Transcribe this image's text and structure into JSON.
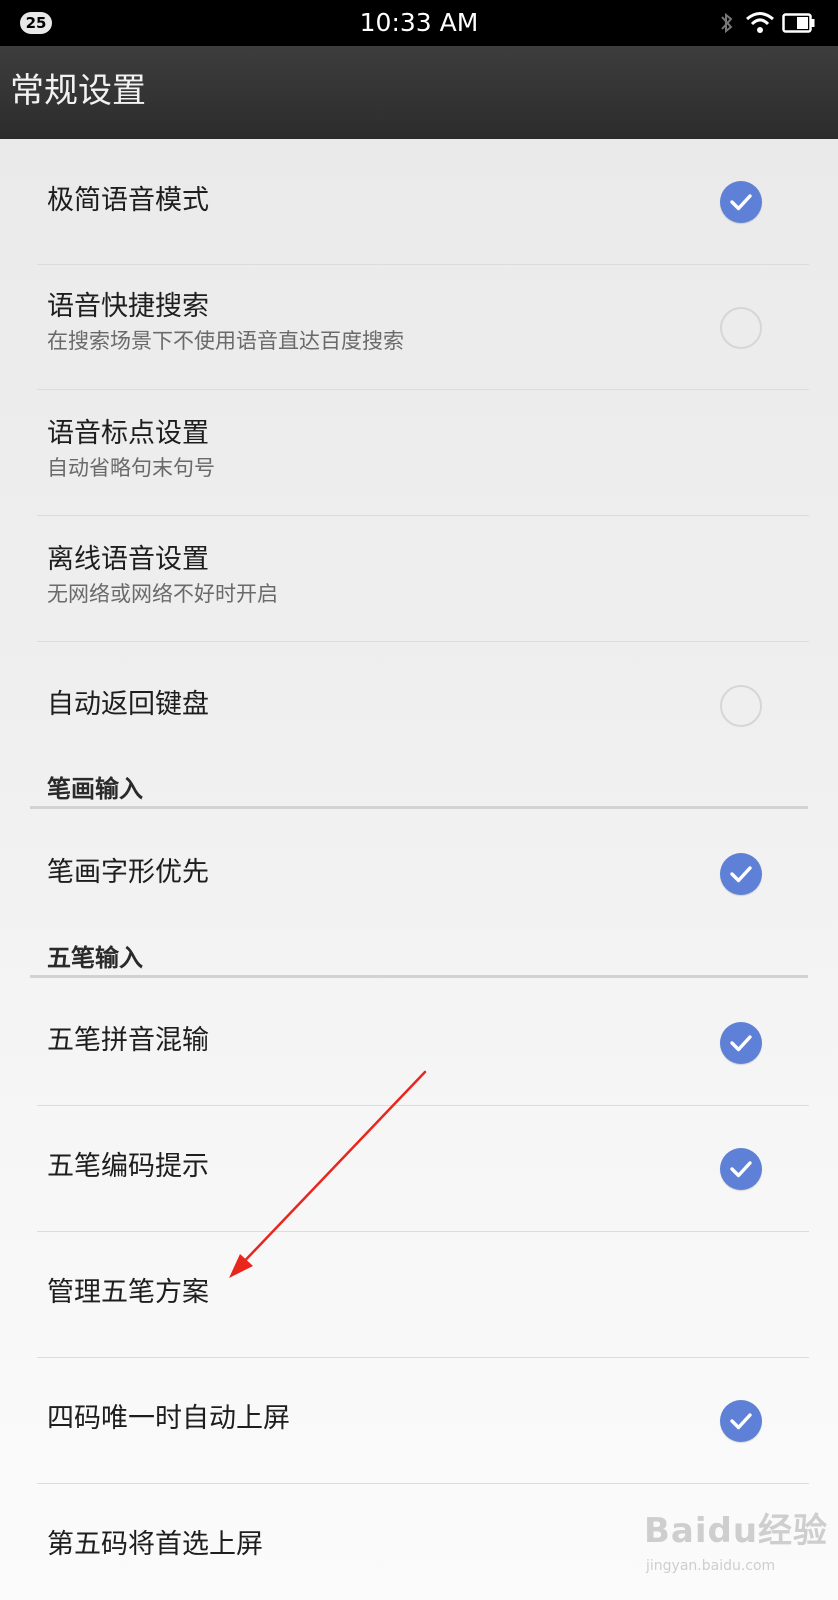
{
  "status_bar": {
    "notification_count": "25",
    "time": "10:33 AM",
    "icons": [
      "bluetooth-icon",
      "wifi-icon",
      "battery-icon"
    ]
  },
  "header": {
    "title": "常规设置"
  },
  "items": [
    {
      "title": "极简语音模式",
      "subtitle": "",
      "control": "checked"
    },
    {
      "title": "语音快捷搜索",
      "subtitle": "在搜索场景下不使用语音直达百度搜索",
      "control": "unchecked"
    },
    {
      "title": "语音标点设置",
      "subtitle": "自动省略句末句号",
      "control": "none"
    },
    {
      "title": "离线语音设置",
      "subtitle": "无网络或网络不好时开启",
      "control": "none"
    },
    {
      "title": "自动返回键盘",
      "subtitle": "",
      "control": "unchecked"
    },
    {
      "title": "笔画字形优先",
      "subtitle": "",
      "control": "checked"
    },
    {
      "title": "五笔拼音混输",
      "subtitle": "",
      "control": "checked"
    },
    {
      "title": "五笔编码提示",
      "subtitle": "",
      "control": "checked"
    },
    {
      "title": "管理五笔方案",
      "subtitle": "",
      "control": "none"
    },
    {
      "title": "四码唯一时自动上屏",
      "subtitle": "",
      "control": "checked"
    },
    {
      "title": "第五码将首选上屏",
      "subtitle": "",
      "control": "none"
    }
  ],
  "sections": {
    "stroke_input": "笔画输入",
    "wubi_input": "五笔输入"
  },
  "colors": {
    "check_blue": "#5e80d6",
    "arrow_red": "#e8261e",
    "title_bar": "#333333"
  },
  "watermark": {
    "main": "Baidu经验",
    "sub": "jingyan.baidu.com"
  }
}
